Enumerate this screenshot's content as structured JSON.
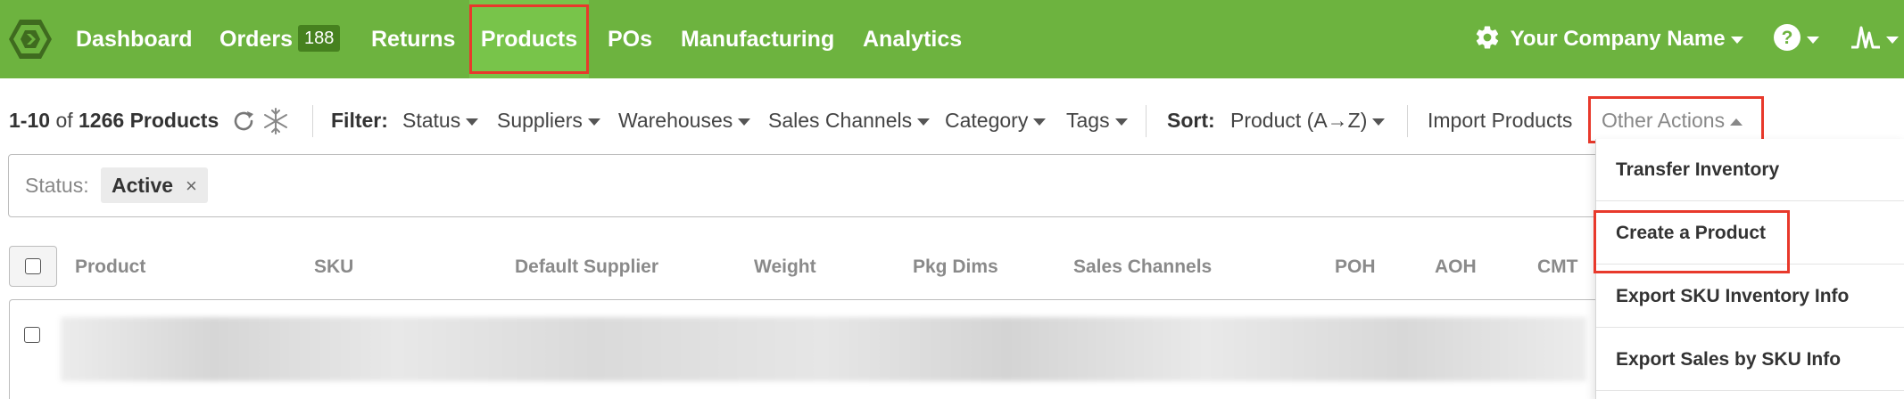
{
  "nav": {
    "items": [
      {
        "label": "Dashboard"
      },
      {
        "label": "Orders",
        "badge": "188"
      },
      {
        "label": "Returns"
      },
      {
        "label": "Products"
      },
      {
        "label": "POs"
      },
      {
        "label": "Manufacturing"
      },
      {
        "label": "Analytics"
      }
    ],
    "company": "Your Company Name",
    "help_icon": "question-circle-icon",
    "user_icon": "activity-icon",
    "brand_color": "#6db33f",
    "highlight_color": "#e8392b"
  },
  "toolbar": {
    "count_range": "1-10",
    "count_of": "of",
    "count_total": "1266 Products",
    "filter_label": "Filter:",
    "filters": [
      "Status",
      "Suppliers",
      "Warehouses",
      "Sales Channels",
      "Category",
      "Tags"
    ],
    "sort_label": "Sort:",
    "sort_value": "Product (A→Z)",
    "import_label": "Import Products",
    "other_actions_label": "Other Actions"
  },
  "active_filter": {
    "label": "Status:",
    "value": "Active",
    "remove": "×"
  },
  "table": {
    "columns": [
      "Product",
      "SKU",
      "Default Supplier",
      "Weight",
      "Pkg Dims",
      "Sales Channels",
      "POH",
      "AOH",
      "CMT"
    ]
  },
  "other_actions_menu": {
    "items": [
      "Transfer Inventory",
      "Create a Product",
      "Export SKU Inventory Info",
      "Export Sales by SKU Info"
    ]
  }
}
